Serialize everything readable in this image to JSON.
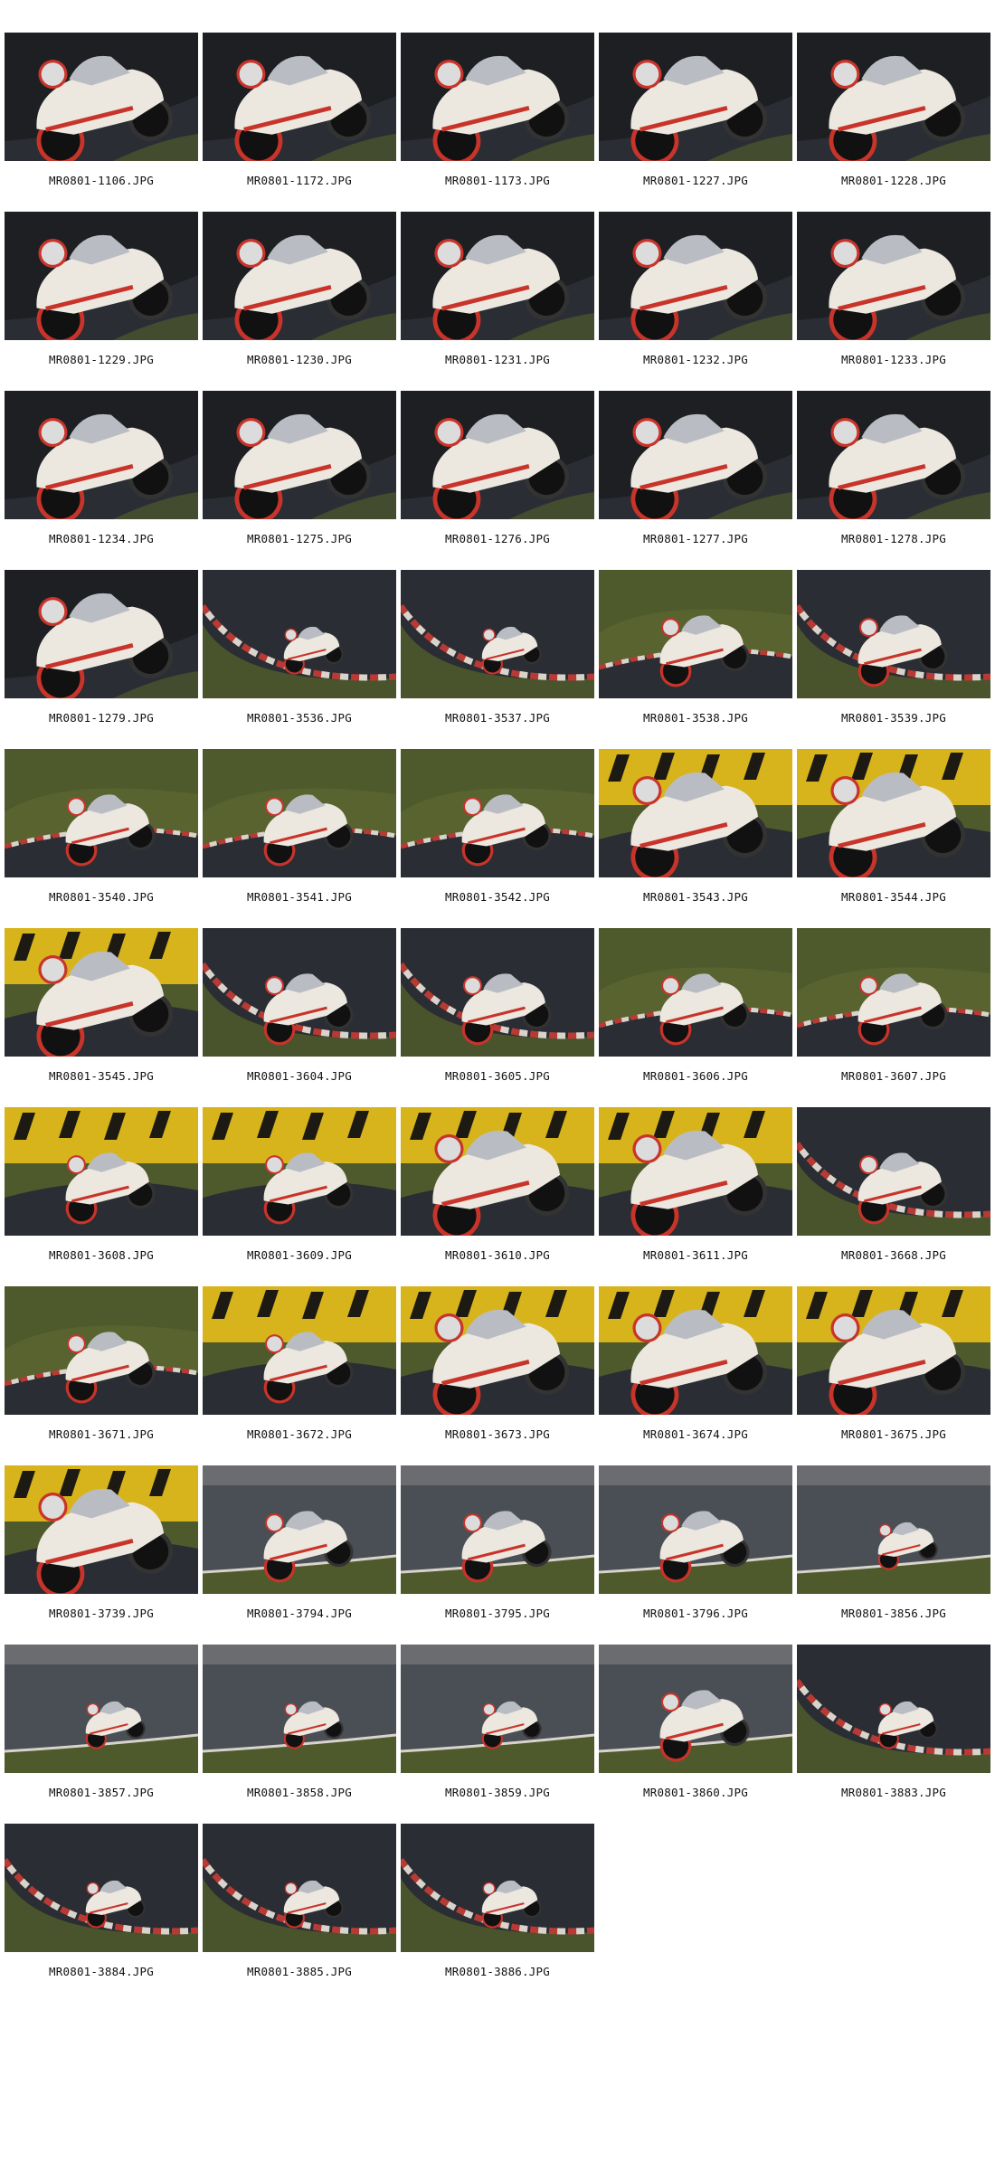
{
  "sheet": {
    "photos": [
      {
        "file": "MR0801-1106.JPG",
        "scene": "dark",
        "zoom": "close"
      },
      {
        "file": "MR0801-1172.JPG",
        "scene": "dark",
        "zoom": "close"
      },
      {
        "file": "MR0801-1173.JPG",
        "scene": "dark",
        "zoom": "close"
      },
      {
        "file": "MR0801-1227.JPG",
        "scene": "dark",
        "zoom": "close"
      },
      {
        "file": "MR0801-1228.JPG",
        "scene": "dark",
        "zoom": "close"
      },
      {
        "file": "MR0801-1229.JPG",
        "scene": "dark",
        "zoom": "close"
      },
      {
        "file": "MR0801-1230.JPG",
        "scene": "dark",
        "zoom": "close"
      },
      {
        "file": "MR0801-1231.JPG",
        "scene": "dark",
        "zoom": "close"
      },
      {
        "file": "MR0801-1232.JPG",
        "scene": "dark",
        "zoom": "close"
      },
      {
        "file": "MR0801-1233.JPG",
        "scene": "dark",
        "zoom": "close"
      },
      {
        "file": "MR0801-1234.JPG",
        "scene": "dark",
        "zoom": "close"
      },
      {
        "file": "MR0801-1275.JPG",
        "scene": "dark",
        "zoom": "close"
      },
      {
        "file": "MR0801-1276.JPG",
        "scene": "dark",
        "zoom": "close"
      },
      {
        "file": "MR0801-1277.JPG",
        "scene": "dark",
        "zoom": "close"
      },
      {
        "file": "MR0801-1278.JPG",
        "scene": "dark",
        "zoom": "close"
      },
      {
        "file": "MR0801-1279.JPG",
        "scene": "dark",
        "zoom": "close"
      },
      {
        "file": "MR0801-3536.JPG",
        "scene": "curb",
        "zoom": "far"
      },
      {
        "file": "MR0801-3537.JPG",
        "scene": "curb",
        "zoom": "far"
      },
      {
        "file": "MR0801-3538.JPG",
        "scene": "grass",
        "zoom": "mid"
      },
      {
        "file": "MR0801-3539.JPG",
        "scene": "curb",
        "zoom": "mid"
      },
      {
        "file": "MR0801-3540.JPG",
        "scene": "grass",
        "zoom": "mid"
      },
      {
        "file": "MR0801-3541.JPG",
        "scene": "grass",
        "zoom": "mid"
      },
      {
        "file": "MR0801-3542.JPG",
        "scene": "grass",
        "zoom": "mid"
      },
      {
        "file": "MR0801-3543.JPG",
        "scene": "yellow",
        "zoom": "close"
      },
      {
        "file": "MR0801-3544.JPG",
        "scene": "yellow",
        "zoom": "close"
      },
      {
        "file": "MR0801-3545.JPG",
        "scene": "yellow",
        "zoom": "close"
      },
      {
        "file": "MR0801-3604.JPG",
        "scene": "curb",
        "zoom": "mid"
      },
      {
        "file": "MR0801-3605.JPG",
        "scene": "curb",
        "zoom": "mid"
      },
      {
        "file": "MR0801-3606.JPG",
        "scene": "grass",
        "zoom": "mid"
      },
      {
        "file": "MR0801-3607.JPG",
        "scene": "grass",
        "zoom": "mid"
      },
      {
        "file": "MR0801-3608.JPG",
        "scene": "yellow",
        "zoom": "mid"
      },
      {
        "file": "MR0801-3609.JPG",
        "scene": "yellow",
        "zoom": "mid"
      },
      {
        "file": "MR0801-3610.JPG",
        "scene": "yellow",
        "zoom": "close"
      },
      {
        "file": "MR0801-3611.JPG",
        "scene": "yellow",
        "zoom": "close"
      },
      {
        "file": "MR0801-3668.JPG",
        "scene": "curb",
        "zoom": "mid"
      },
      {
        "file": "MR0801-3671.JPG",
        "scene": "grass",
        "zoom": "mid"
      },
      {
        "file": "MR0801-3672.JPG",
        "scene": "yellow",
        "zoom": "mid"
      },
      {
        "file": "MR0801-3673.JPG",
        "scene": "yellow",
        "zoom": "close"
      },
      {
        "file": "MR0801-3674.JPG",
        "scene": "yellow",
        "zoom": "close"
      },
      {
        "file": "MR0801-3675.JPG",
        "scene": "yellow",
        "zoom": "close"
      },
      {
        "file": "MR0801-3739.JPG",
        "scene": "yellow",
        "zoom": "close"
      },
      {
        "file": "MR0801-3794.JPG",
        "scene": "gray",
        "zoom": "mid"
      },
      {
        "file": "MR0801-3795.JPG",
        "scene": "gray",
        "zoom": "mid"
      },
      {
        "file": "MR0801-3796.JPG",
        "scene": "gray",
        "zoom": "mid"
      },
      {
        "file": "MR0801-3856.JPG",
        "scene": "gray",
        "zoom": "far"
      },
      {
        "file": "MR0801-3857.JPG",
        "scene": "gray",
        "zoom": "far"
      },
      {
        "file": "MR0801-3858.JPG",
        "scene": "gray",
        "zoom": "far"
      },
      {
        "file": "MR0801-3859.JPG",
        "scene": "gray",
        "zoom": "far"
      },
      {
        "file": "MR0801-3860.JPG",
        "scene": "gray",
        "zoom": "mid"
      },
      {
        "file": "MR0801-3883.JPG",
        "scene": "curb",
        "zoom": "far"
      },
      {
        "file": "MR0801-3884.JPG",
        "scene": "curb",
        "zoom": "far"
      },
      {
        "file": "MR0801-3885.JPG",
        "scene": "curb",
        "zoom": "far"
      },
      {
        "file": "MR0801-3886.JPG",
        "scene": "curb",
        "zoom": "far"
      }
    ]
  },
  "palette": {
    "page_bg": "#ffffff",
    "caption_text": "#111111",
    "asphalt": "#2a2d33",
    "asphalt_light": "#4a4e55",
    "grass": "#4f5a2c",
    "grass_light": "#6b7536",
    "barrier_yellow": "#d8b41c",
    "barrier_black": "#1c1a12",
    "curb_red": "#b83a34",
    "curb_white": "#d8d4cc",
    "bike_white": "#ece8e0",
    "bike_red": "#c8342a",
    "rider_gray": "#b9bcc2",
    "helmet": "#dcdcdc"
  }
}
